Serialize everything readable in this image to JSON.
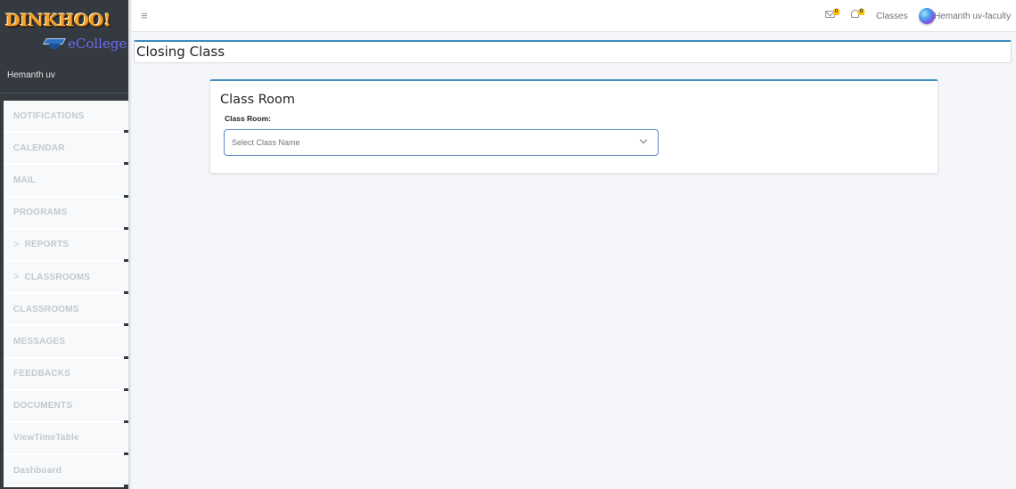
{
  "brand": {
    "name": "DINKHOO!",
    "subtitle": "eCollege"
  },
  "user": {
    "name": "Hemanth uv"
  },
  "sidebar": {
    "items": [
      {
        "label": "NOTIFICATIONS",
        "chevron": false
      },
      {
        "label": "CALENDAR",
        "chevron": false
      },
      {
        "label": "MAIL",
        "chevron": false
      },
      {
        "label": "PROGRAMS",
        "chevron": false
      },
      {
        "label": "REPORTS",
        "chevron": true
      },
      {
        "label": "CLASSROOMS",
        "chevron": true
      },
      {
        "label": "CLASSROOMS",
        "chevron": false
      },
      {
        "label": "MESSAGES",
        "chevron": false
      },
      {
        "label": "FEEDBACKS",
        "chevron": false
      },
      {
        "label": "DOCUMENTS",
        "chevron": false
      },
      {
        "label": "ViewTimeTable",
        "chevron": false
      },
      {
        "label": "Dashboard",
        "chevron": false
      }
    ],
    "chevron_glyph": ">"
  },
  "topbar": {
    "menu_icon": "≡",
    "mail_badge": "0",
    "notification_badge": "0",
    "classes_label": "Classes",
    "profile_name": "Hemanth uv-faculty"
  },
  "page": {
    "title": "Closing Class"
  },
  "card": {
    "title": "Class Room",
    "field_label": "Class Room:",
    "select_placeholder": "Select Class Name"
  }
}
